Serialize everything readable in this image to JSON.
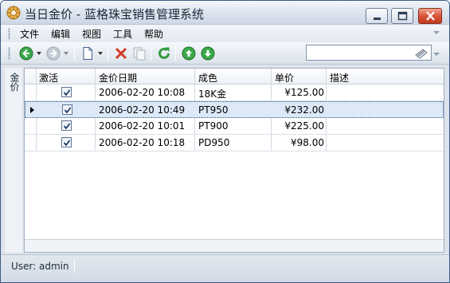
{
  "window": {
    "title": "当日金价 - 蓝格珠宝销售管理系统",
    "icon": "gear-logo-icon"
  },
  "caption_buttons": [
    "minimize",
    "maximize",
    "close"
  ],
  "menu": {
    "items": [
      "文件",
      "编辑",
      "视图",
      "工具",
      "帮助"
    ]
  },
  "toolbar": {
    "buttons": [
      "back-icon",
      "forward-icon",
      "new-document-icon",
      "delete-icon",
      "copy-icon",
      "refresh-icon",
      "move-up-icon",
      "move-down-icon"
    ],
    "search_value": ""
  },
  "sidebar": {
    "tab_label": "金价"
  },
  "grid": {
    "columns": [
      "激活",
      "金价日期",
      "成色",
      "单价",
      "描述"
    ],
    "rows": [
      {
        "active": true,
        "date": "2006-02-20 10:08",
        "purity": "18K金",
        "price": "¥125.00",
        "desc": ""
      },
      {
        "active": true,
        "date": "2006-02-20 10:49",
        "purity": "PT950",
        "price": "¥232.00",
        "desc": ""
      },
      {
        "active": true,
        "date": "2006-02-20 10:01",
        "purity": "PT900",
        "price": "¥225.00",
        "desc": ""
      },
      {
        "active": true,
        "date": "2006-02-20 10:18",
        "purity": "PD950",
        "price": "¥98.00",
        "desc": ""
      }
    ],
    "selected_row": 1
  },
  "status": {
    "user_text": "User: admin"
  },
  "colors": {
    "accent_green": "#2f9a3a",
    "delete_red": "#d43a2a",
    "selection": "#dde9f7"
  }
}
